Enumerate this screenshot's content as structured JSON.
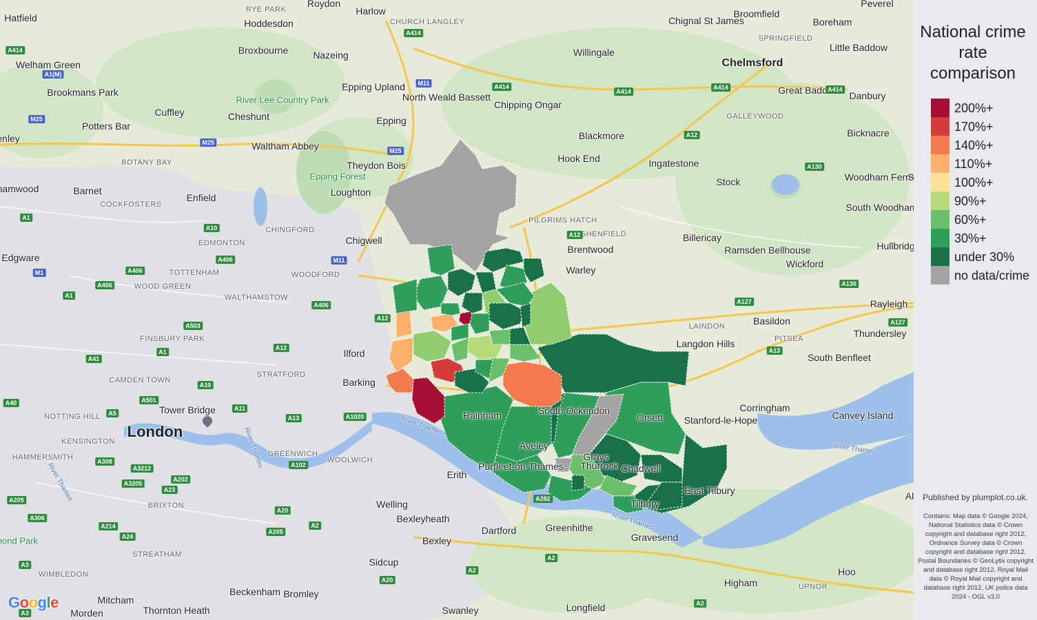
{
  "legend": {
    "title": "National crime rate comparison",
    "items": [
      {
        "label": "200%+",
        "color": "#a50f35"
      },
      {
        "label": "170%+",
        "color": "#d73a3a"
      },
      {
        "label": "140%+",
        "color": "#f47a4e"
      },
      {
        "label": "110%+",
        "color": "#fcb06a"
      },
      {
        "label": "100%+",
        "color": "#fde39a"
      },
      {
        "label": "90%+",
        "color": "#b6dc7a"
      },
      {
        "label": "60%+",
        "color": "#6cbf6a"
      },
      {
        "label": "30%+",
        "color": "#2e9e5b"
      },
      {
        "label": "under 30%",
        "color": "#18714a"
      },
      {
        "label": "no data/crime",
        "color": "#a3a3a3"
      }
    ]
  },
  "published": "Published by plumplot.co.uk.",
  "credits": "Contains: Map data © Google 2024, National Statistics data © Crown copyright and database right 2012, Ordnance Survey data © Crown copyright and database right 2012, Postal Boundaries © GeoLytix copyright and database right 2012, Royal Mail data © Royal Mail copyright and database right 2012, UK police data 2024 - OGL v3.0",
  "map": {
    "google_logo": "Google",
    "place_labels": [
      {
        "id": "hatfield",
        "text": "Hatfield",
        "kind": "town"
      },
      {
        "id": "rye-park",
        "text": "RYE PARK",
        "kind": "district"
      },
      {
        "id": "roydon",
        "text": "Roydon",
        "kind": "town"
      },
      {
        "id": "harlow",
        "text": "Harlow",
        "kind": "town"
      },
      {
        "id": "church-langley",
        "text": "CHURCH LANGLEY",
        "kind": "district"
      },
      {
        "id": "hoddesdon",
        "text": "Hoddesdon",
        "kind": "town"
      },
      {
        "id": "chignal",
        "text": "Chignal St James",
        "kind": "town"
      },
      {
        "id": "broomfield",
        "text": "Broomfield",
        "kind": "town"
      },
      {
        "id": "pleshey",
        "text": "Peverel",
        "kind": "town"
      },
      {
        "id": "boreham",
        "text": "Boreham",
        "kind": "town"
      },
      {
        "id": "springfield",
        "text": "SPRINGFIELD",
        "kind": "district"
      },
      {
        "id": "welham",
        "text": "Welham Green",
        "kind": "town"
      },
      {
        "id": "broxbourne",
        "text": "Broxbourne",
        "kind": "town"
      },
      {
        "id": "nazeing",
        "text": "Nazeing",
        "kind": "town"
      },
      {
        "id": "willingale",
        "text": "Willingale",
        "kind": "town"
      },
      {
        "id": "chelmsford",
        "text": "Chelmsford",
        "kind": "major"
      },
      {
        "id": "little-baddow",
        "text": "Little Baddow",
        "kind": "town"
      },
      {
        "id": "brookmans",
        "text": "Brookmans Park",
        "kind": "town"
      },
      {
        "id": "river-lee",
        "text": "River Lee Country Park",
        "kind": "park"
      },
      {
        "id": "epping-upland",
        "text": "Epping Upland",
        "kind": "town"
      },
      {
        "id": "north-weald",
        "text": "North Weald Bassett",
        "kind": "town"
      },
      {
        "id": "chipping-ongar",
        "text": "Chipping Ongar",
        "kind": "town"
      },
      {
        "id": "great-baddow",
        "text": "Great Baddow",
        "kind": "town"
      },
      {
        "id": "danbury",
        "text": "Danbury",
        "kind": "town"
      },
      {
        "id": "cuffley",
        "text": "Cuffley",
        "kind": "town"
      },
      {
        "id": "cheshunt",
        "text": "Cheshunt",
        "kind": "town"
      },
      {
        "id": "epping",
        "text": "Epping",
        "kind": "town"
      },
      {
        "id": "galleywood",
        "text": "GALLEYWOOD",
        "kind": "district"
      },
      {
        "id": "potters-bar",
        "text": "Potters Bar",
        "kind": "town"
      },
      {
        "id": "blackmore",
        "text": "Blackmore",
        "kind": "town"
      },
      {
        "id": "bicknacre",
        "text": "Bicknacre",
        "kind": "town"
      },
      {
        "id": "enley",
        "text": "enley",
        "kind": "town"
      },
      {
        "id": "waltham-abbey",
        "text": "Waltham Abbey",
        "kind": "town"
      },
      {
        "id": "theydon",
        "text": "Theydon Bois",
        "kind": "town"
      },
      {
        "id": "hook-end",
        "text": "Hook End",
        "kind": "town"
      },
      {
        "id": "ingatestone",
        "text": "Ingatestone",
        "kind": "town"
      },
      {
        "id": "botany-bay",
        "text": "BOTANY BAY",
        "kind": "district"
      },
      {
        "id": "epping-forest",
        "text": "Epping Forest",
        "kind": "park"
      },
      {
        "id": "woodham-ferrers",
        "text": "Woodham Ferrers",
        "kind": "town"
      },
      {
        "id": "hamwood",
        "text": "hamwood",
        "kind": "town"
      },
      {
        "id": "barnet",
        "text": "Barnet",
        "kind": "town"
      },
      {
        "id": "loughton",
        "text": "Loughton",
        "kind": "town"
      },
      {
        "id": "stock",
        "text": "Stock",
        "kind": "town"
      },
      {
        "id": "cockfosters",
        "text": "COCKFOSTERS",
        "kind": "district"
      },
      {
        "id": "enfield",
        "text": "Enfield",
        "kind": "town"
      },
      {
        "id": "south-woodham",
        "text": "South Woodham Ferrers",
        "kind": "town"
      },
      {
        "id": "pilgrims-hatch",
        "text": "PILGRIMS HATCH",
        "kind": "district"
      },
      {
        "id": "chingford",
        "text": "CHINGFORD",
        "kind": "district"
      },
      {
        "id": "shenfield",
        "text": "SHENFIELD",
        "kind": "district"
      },
      {
        "id": "billericay",
        "text": "Billericay",
        "kind": "town"
      },
      {
        "id": "edmonton",
        "text": "EDMONTON",
        "kind": "district"
      },
      {
        "id": "chigwell",
        "text": "Chigwell",
        "kind": "town"
      },
      {
        "id": "brentwood",
        "text": "Brentwood",
        "kind": "town"
      },
      {
        "id": "ramsden",
        "text": "Ramsden Bellhouse",
        "kind": "town"
      },
      {
        "id": "hullbridge",
        "text": "Hullbridg",
        "kind": "town"
      },
      {
        "id": "edgware",
        "text": "Edgware",
        "kind": "town"
      },
      {
        "id": "wickford",
        "text": "Wickford",
        "kind": "town"
      },
      {
        "id": "tottenham",
        "text": "TOTTENHAM",
        "kind": "district"
      },
      {
        "id": "woodford",
        "text": "WOODFORD",
        "kind": "district"
      },
      {
        "id": "warley",
        "text": "Warley",
        "kind": "town"
      },
      {
        "id": "wood-green",
        "text": "WOOD GREEN",
        "kind": "district"
      },
      {
        "id": "walthamstow",
        "text": "WALTHAMSTOW",
        "kind": "district"
      },
      {
        "id": "rayleigh",
        "text": "Rayleigh",
        "kind": "town"
      },
      {
        "id": "basildon",
        "text": "Basildon",
        "kind": "town"
      },
      {
        "id": "laindon",
        "text": "LAINDON",
        "kind": "district"
      },
      {
        "id": "finsbury",
        "text": "FINSBURY PARK",
        "kind": "district"
      },
      {
        "id": "pitsea",
        "text": "PITSEA",
        "kind": "district"
      },
      {
        "id": "thundersley",
        "text": "Thundersley",
        "kind": "town"
      },
      {
        "id": "langdon",
        "text": "Langdon Hills",
        "kind": "town"
      },
      {
        "id": "ilford",
        "text": "Ilford",
        "kind": "town"
      },
      {
        "id": "south-benfleet",
        "text": "South Benfleet",
        "kind": "town"
      },
      {
        "id": "stratford",
        "text": "STRATFORD",
        "kind": "district"
      },
      {
        "id": "camden",
        "text": "CAMDEN TOWN",
        "kind": "district"
      },
      {
        "id": "barking",
        "text": "Barking",
        "kind": "town"
      },
      {
        "id": "corringham",
        "text": "Corringham",
        "kind": "town"
      },
      {
        "id": "tower-bridge",
        "text": "Tower Bridge",
        "kind": "town"
      },
      {
        "id": "notting-hill",
        "text": "NOTTING HILL",
        "kind": "district"
      },
      {
        "id": "canvey",
        "text": "Canvey Island",
        "kind": "town"
      },
      {
        "id": "stanford",
        "text": "Stanford-le-Hope",
        "kind": "town"
      },
      {
        "id": "london",
        "text": "London",
        "kind": "city"
      },
      {
        "id": "kensington",
        "text": "KENSINGTON",
        "kind": "district"
      },
      {
        "id": "greenwich",
        "text": "GREENWICH",
        "kind": "district"
      },
      {
        "id": "woolwich",
        "text": "WOOLWICH",
        "kind": "district"
      },
      {
        "id": "hammersmith",
        "text": "HAMMERSMITH",
        "kind": "district"
      },
      {
        "id": "erith",
        "text": "Erith",
        "kind": "town"
      },
      {
        "id": "purfleet",
        "text": "Purfleet-on-Thames",
        "kind": "town"
      },
      {
        "id": "brixton",
        "text": "BRIXTON",
        "kind": "district"
      },
      {
        "id": "welling",
        "text": "Welling",
        "kind": "town"
      },
      {
        "id": "tilbury",
        "text": "Tilbury",
        "kind": "town"
      },
      {
        "id": "east-tilbury",
        "text": "East Tilbury",
        "kind": "town"
      },
      {
        "id": "bexleyheath",
        "text": "Bexleyheath",
        "kind": "town"
      },
      {
        "id": "dartford",
        "text": "Dartford",
        "kind": "town"
      },
      {
        "id": "greenhithe",
        "text": "Greenhithe",
        "kind": "town"
      },
      {
        "id": "gravesend",
        "text": "Gravesend",
        "kind": "town"
      },
      {
        "id": "richmond",
        "text": "hmond Park",
        "kind": "park"
      },
      {
        "id": "bexley",
        "text": "Bexley",
        "kind": "town"
      },
      {
        "id": "streatham",
        "text": "STREATHAM",
        "kind": "district"
      },
      {
        "id": "wimbledon",
        "text": "WIMBLEDON",
        "kind": "district"
      },
      {
        "id": "sidcup",
        "text": "Sidcup",
        "kind": "town"
      },
      {
        "id": "hoo",
        "text": "Hoo",
        "kind": "town"
      },
      {
        "id": "higham",
        "text": "Higham",
        "kind": "town"
      },
      {
        "id": "upnor",
        "text": "UPNOR",
        "kind": "district"
      },
      {
        "id": "beckenham",
        "text": "Beckenham",
        "kind": "town"
      },
      {
        "id": "bromley",
        "text": "Bromley",
        "kind": "town"
      },
      {
        "id": "mitcham",
        "text": "Mitcham",
        "kind": "town"
      },
      {
        "id": "thornton",
        "text": "Thornton Heath",
        "kind": "town"
      },
      {
        "id": "longfield",
        "text": "Longfield",
        "kind": "town"
      },
      {
        "id": "morden",
        "text": "Morden",
        "kind": "town"
      },
      {
        "id": "swanley",
        "text": "Swanley",
        "kind": "town"
      },
      {
        "id": "orsett",
        "text": "Orsett",
        "kind": "town"
      },
      {
        "id": "aveley",
        "text": "Aveley",
        "kind": "town"
      },
      {
        "id": "south-ockendon",
        "text": "South Ockendon",
        "kind": "town"
      },
      {
        "id": "rainham",
        "text": "Rainham",
        "kind": "town"
      },
      {
        "id": "grays",
        "text": "Grays",
        "kind": "town"
      },
      {
        "id": "chadwell",
        "text": "Chadwell",
        "kind": "town"
      },
      {
        "id": "thurrock",
        "text": "Thurrock",
        "kind": "town"
      },
      {
        "id": "river-thames-1",
        "text": "River Thames",
        "kind": "river"
      },
      {
        "id": "river-thames-2",
        "text": "River Thames",
        "kind": "river"
      },
      {
        "id": "river-thames-3",
        "text": "River Thames",
        "kind": "river"
      },
      {
        "id": "river-thames-4",
        "text": "River Thames",
        "kind": "river"
      },
      {
        "id": "river-thames-5",
        "text": "River Thames",
        "kind": "river"
      },
      {
        "id": "hawley",
        "text": "Al",
        "kind": "town"
      },
      {
        "id": "sm",
        "text": "S",
        "kind": "town"
      }
    ],
    "road_shields": [
      {
        "id": "r1",
        "text": "A414",
        "kind": "a"
      },
      {
        "id": "r2",
        "text": "A1(M)",
        "kind": "m"
      },
      {
        "id": "r3",
        "text": "A414",
        "kind": "a"
      },
      {
        "id": "r4",
        "text": "M11",
        "kind": "m"
      },
      {
        "id": "r5",
        "text": "A414",
        "kind": "a"
      },
      {
        "id": "r6",
        "text": "A414",
        "kind": "a"
      },
      {
        "id": "r7",
        "text": "A414",
        "kind": "a"
      },
      {
        "id": "r8",
        "text": "A414",
        "kind": "a"
      },
      {
        "id": "r9",
        "text": "M25",
        "kind": "m"
      },
      {
        "id": "r10",
        "text": "M25",
        "kind": "m"
      },
      {
        "id": "r11",
        "text": "M25",
        "kind": "m"
      },
      {
        "id": "r12",
        "text": "A12",
        "kind": "a"
      },
      {
        "id": "r13",
        "text": "A130",
        "kind": "a"
      },
      {
        "id": "r14",
        "text": "A1",
        "kind": "a"
      },
      {
        "id": "r15",
        "text": "A10",
        "kind": "a"
      },
      {
        "id": "r16",
        "text": "A12",
        "kind": "a"
      },
      {
        "id": "r17",
        "text": "A406",
        "kind": "a"
      },
      {
        "id": "r18",
        "text": "M11",
        "kind": "m"
      },
      {
        "id": "r19",
        "text": "M1",
        "kind": "m"
      },
      {
        "id": "r20",
        "text": "A406",
        "kind": "a"
      },
      {
        "id": "r21",
        "text": "A406",
        "kind": "a"
      },
      {
        "id": "r22",
        "text": "A406",
        "kind": "a"
      },
      {
        "id": "r23",
        "text": "A1",
        "kind": "a"
      },
      {
        "id": "r24",
        "text": "A12",
        "kind": "a"
      },
      {
        "id": "r25",
        "text": "A503",
        "kind": "a"
      },
      {
        "id": "r26",
        "text": "A1",
        "kind": "a"
      },
      {
        "id": "r27",
        "text": "A12",
        "kind": "a"
      },
      {
        "id": "r28",
        "text": "A41",
        "kind": "a"
      },
      {
        "id": "r29",
        "text": "A10",
        "kind": "a"
      },
      {
        "id": "r30",
        "text": "A501",
        "kind": "a"
      },
      {
        "id": "r31",
        "text": "A11",
        "kind": "a"
      },
      {
        "id": "r32",
        "text": "A40",
        "kind": "a"
      },
      {
        "id": "r33",
        "text": "A5",
        "kind": "a"
      },
      {
        "id": "r34",
        "text": "A13",
        "kind": "a"
      },
      {
        "id": "r35",
        "text": "A1020",
        "kind": "a"
      },
      {
        "id": "r36",
        "text": "A130",
        "kind": "a"
      },
      {
        "id": "r37",
        "text": "A127",
        "kind": "a"
      },
      {
        "id": "r38",
        "text": "A127",
        "kind": "a"
      },
      {
        "id": "r39",
        "text": "A13",
        "kind": "a"
      },
      {
        "id": "r40",
        "text": "A308",
        "kind": "a"
      },
      {
        "id": "r41",
        "text": "A3212",
        "kind": "a"
      },
      {
        "id": "r42",
        "text": "A3205",
        "kind": "a"
      },
      {
        "id": "r43",
        "text": "A202",
        "kind": "a"
      },
      {
        "id": "r44",
        "text": "A23",
        "kind": "a"
      },
      {
        "id": "r45",
        "text": "A102",
        "kind": "a"
      },
      {
        "id": "r46",
        "text": "A205",
        "kind": "a"
      },
      {
        "id": "r47",
        "text": "A306",
        "kind": "a"
      },
      {
        "id": "r48",
        "text": "A214",
        "kind": "a"
      },
      {
        "id": "r49",
        "text": "A24",
        "kind": "a"
      },
      {
        "id": "r50",
        "text": "A20",
        "kind": "a"
      },
      {
        "id": "r51",
        "text": "A2",
        "kind": "a"
      },
      {
        "id": "r52",
        "text": "A205",
        "kind": "a"
      },
      {
        "id": "r53",
        "text": "A3",
        "kind": "a"
      },
      {
        "id": "r54",
        "text": "A282",
        "kind": "a"
      },
      {
        "id": "r55",
        "text": "A2",
        "kind": "a"
      },
      {
        "id": "r56",
        "text": "A2",
        "kind": "a"
      },
      {
        "id": "r57",
        "text": "A20",
        "kind": "a"
      },
      {
        "id": "r58",
        "text": "A2",
        "kind": "a"
      },
      {
        "id": "r59",
        "text": "A3",
        "kind": "a"
      },
      {
        "id": "r60",
        "text": "A1306",
        "kind": "a"
      }
    ]
  }
}
